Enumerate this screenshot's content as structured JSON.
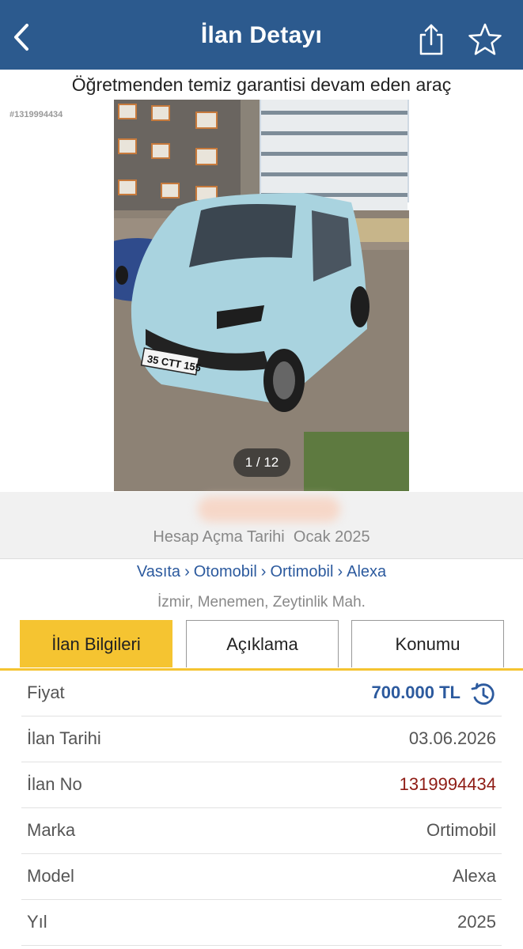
{
  "header": {
    "title": "İlan Detayı",
    "back_icon": "chevron-left-icon",
    "share_icon": "share-icon",
    "favorite_icon": "star-icon",
    "bg_color": "#2c5a8e"
  },
  "listing": {
    "title": "Öğretmenden temiz garantisi devam eden araç",
    "photo_id": "#1319994434",
    "photo_counter": "1 / 12",
    "plate": "35 CTT 155"
  },
  "seller": {
    "account_date_label": "Hesap Açma Tarihi",
    "account_date_value": "Ocak 2025"
  },
  "breadcrumb": [
    "Vasıta",
    "Otomobil",
    "Ortimobil",
    "Alexa"
  ],
  "breadcrumb_separator": "›",
  "location": "İzmir, Menemen, Zeytinlik Mah.",
  "tabs": [
    {
      "label": "İlan Bilgileri",
      "active": true
    },
    {
      "label": "Açıklama",
      "active": false
    },
    {
      "label": "Konumu",
      "active": false
    }
  ],
  "details": [
    {
      "label": "Fiyat",
      "value": "700.000 TL"
    },
    {
      "label": "İlan Tarihi",
      "value": "03.06.2026"
    },
    {
      "label": "İlan No",
      "value": "1319994434"
    },
    {
      "label": "Marka",
      "value": "Ortimobil"
    },
    {
      "label": "Model",
      "value": "Alexa"
    },
    {
      "label": "Yıl",
      "value": "2025"
    }
  ],
  "colors": {
    "accent_yellow": "#f5c431",
    "link_blue": "#2c5a9e",
    "listing_no_red": "#8e1b14"
  }
}
